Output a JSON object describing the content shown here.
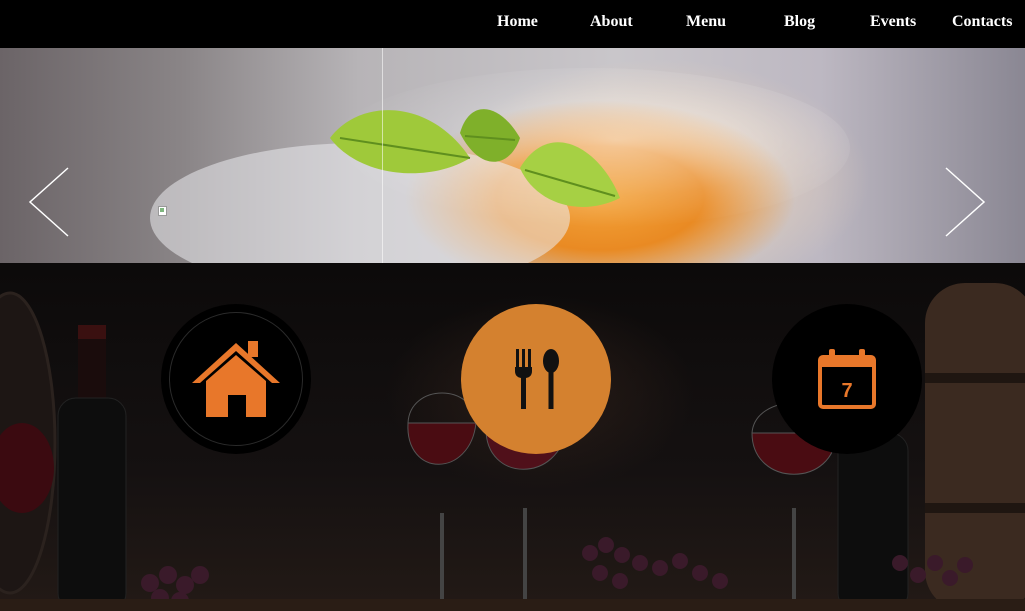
{
  "nav": {
    "items": [
      {
        "label": "Home"
      },
      {
        "label": "About"
      },
      {
        "label": "Menu"
      },
      {
        "label": "Blog"
      },
      {
        "label": "Events"
      },
      {
        "label": "Contacts"
      }
    ]
  },
  "slider": {
    "prev_icon": "chevron-left-icon",
    "next_icon": "chevron-right-icon"
  },
  "features": {
    "home_icon": "house-icon",
    "menu_icon": "fork-spoon-icon",
    "events_icon": "calendar-icon",
    "calendar_day": "7"
  },
  "colors": {
    "accent": "#d4812f",
    "icon_orange": "#e8772a",
    "nav_bg": "#000000",
    "nav_text": "#ffffff"
  }
}
